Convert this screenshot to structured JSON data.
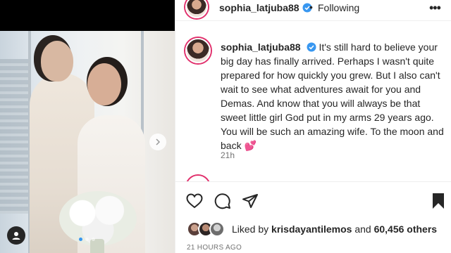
{
  "post": {
    "username": "sophia_latjuba88",
    "follow_status": "Following",
    "separator": "•",
    "more_icon": "more-horizontal-icon"
  },
  "caption": {
    "username": "sophia_latjuba88",
    "text": "It's still hard to believe your big day has finally arrived. Perhaps I wasn't quite prepared for how quickly you grew. But I also can't wait to see what adventures await for you and Demas. And know that you will always be that sweet little girl God put in my arms 29 years ago. You will be such an amazing wife. To the moon and back",
    "emoji": "💕",
    "time": "21h"
  },
  "media": {
    "carousel_dots": 3,
    "active_dot": 0
  },
  "actions": {
    "like_icon": "heart-outline-icon",
    "comment_icon": "comment-bubble-icon",
    "share_icon": "paper-plane-icon",
    "save_icon": "bookmark-icon"
  },
  "likes": {
    "prefix": "Liked by",
    "liker": "krisdayantilemos",
    "conjunction": "and",
    "count": "60,456 others"
  },
  "date": "21 HOURS AGO",
  "colors": {
    "story_ring": "#e1306c",
    "verified": "#3897f0",
    "text": "#262626",
    "muted": "#737373"
  }
}
